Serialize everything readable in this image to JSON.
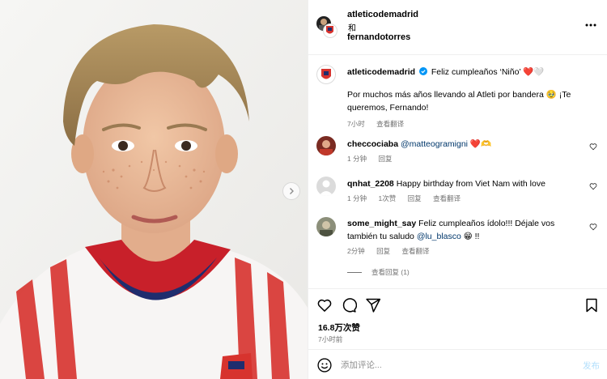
{
  "header": {
    "user1": "atleticodemadrid",
    "conjunction": "和",
    "user2": "fernandotorres",
    "more_icon": "more-horizontal-icon"
  },
  "caption": {
    "username": "atleticodemadrid",
    "verified": true,
    "line1": "Feliz cumpleaños ‘Niño’ ❤️🤍",
    "line2": "Por muchos más años llevando al Atleti por bandera 🥹 ¡Te queremos, Fernando!",
    "time": "7小时",
    "translate": "查看翻译"
  },
  "comments": [
    {
      "username": "checcociaba",
      "text_mention": "@matteogramigni",
      "text_after": " ❤️🫶",
      "time": "1 分钟",
      "reply": "回复"
    },
    {
      "username": "qnhat_2208",
      "text": "Happy birthday from Viet Nam with love",
      "time": "1 分钟",
      "likes": "1次赞",
      "reply": "回复",
      "translate": "查看翻译"
    },
    {
      "username": "some_might_say",
      "text_before": "Feliz cumpleaños ídolo!!! Déjale vos también tu saludo ",
      "text_mention": "@lu_blasco",
      "text_after": " 😁 !!",
      "time": "2分钟",
      "reply": "回复",
      "translate": "查看翻译",
      "view_replies": "查看回复 (1)"
    }
  ],
  "actions": {
    "likes": "16.8万次赞",
    "time": "7小时前"
  },
  "comment_box": {
    "placeholder": "添加评论...",
    "post_label": "发布"
  },
  "colors": {
    "link": "#00376b",
    "meta": "#737373",
    "post_disabled": "#b2dffc",
    "verified": "#0095f6"
  }
}
